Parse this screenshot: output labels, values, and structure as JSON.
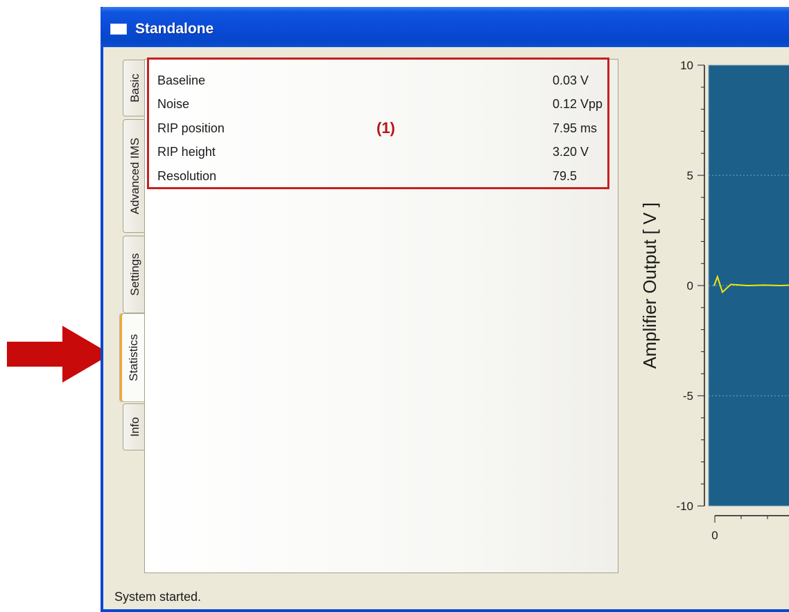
{
  "window": {
    "title": "Standalone"
  },
  "tabs": [
    {
      "label": "Basic",
      "active": false
    },
    {
      "label": "Advanced IMS",
      "active": false
    },
    {
      "label": "Settings",
      "active": false
    },
    {
      "label": "Statistics",
      "active": true
    },
    {
      "label": "Info",
      "active": false
    }
  ],
  "statistics": {
    "callout": "(1)",
    "rows": [
      {
        "label": "Baseline",
        "value": "0.03 V"
      },
      {
        "label": "Noise",
        "value": "0.12 Vpp"
      },
      {
        "label": "RIP position",
        "value": "7.95 ms"
      },
      {
        "label": "RIP height",
        "value": "3.20 V"
      },
      {
        "label": "Resolution",
        "value": "79.5"
      }
    ]
  },
  "status_bar": {
    "text": "System started."
  },
  "colors": {
    "title_bar": "#0a4ad6",
    "highlight_box": "#c81e1e",
    "arrow": "#c80a0a",
    "plot_background": "#1c6089",
    "signal": "#f4e60c",
    "active_tab_accent": "#f1a832"
  },
  "chart_data": {
    "type": "line",
    "title": "",
    "xlabel": "",
    "ylabel": "Amplifier Output [ V ]",
    "ylim": [
      -10,
      10
    ],
    "yticks": [
      10,
      5,
      0,
      -5,
      -10
    ],
    "xticks": [
      0
    ],
    "grid": true,
    "series": [
      {
        "x": [
          0,
          0.2,
          0.5,
          1,
          2,
          3,
          4,
          5
        ],
        "y": [
          0,
          0.4,
          -0.3,
          0.05,
          0,
          0.02,
          0,
          0.03
        ]
      }
    ]
  }
}
